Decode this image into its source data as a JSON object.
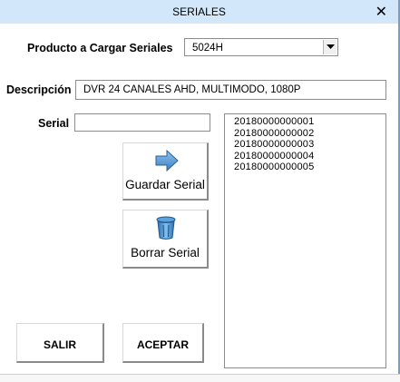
{
  "window": {
    "title": "SERIALES",
    "close_label": "✕"
  },
  "producto": {
    "label": "Producto a Cargar Seriales",
    "selected": "5024H"
  },
  "descripcion": {
    "label": "Descripción",
    "value": "DVR 24 CANALES AHD, MULTIMODO, 1080P"
  },
  "serial": {
    "label": "Serial",
    "value": ""
  },
  "buttons": {
    "guardar": "Guardar Serial",
    "borrar": "Borrar Serial",
    "salir": "SALIR",
    "aceptar": "ACEPTAR"
  },
  "serial_list": [
    "20180000000001",
    "20180000000002",
    "20180000000003",
    "20180000000004",
    "20180000000005"
  ],
  "colors": {
    "titlebar": "#d3e7fa",
    "arrow_icon": "#5b9bd5",
    "trash_icon": "#3a86c8"
  }
}
